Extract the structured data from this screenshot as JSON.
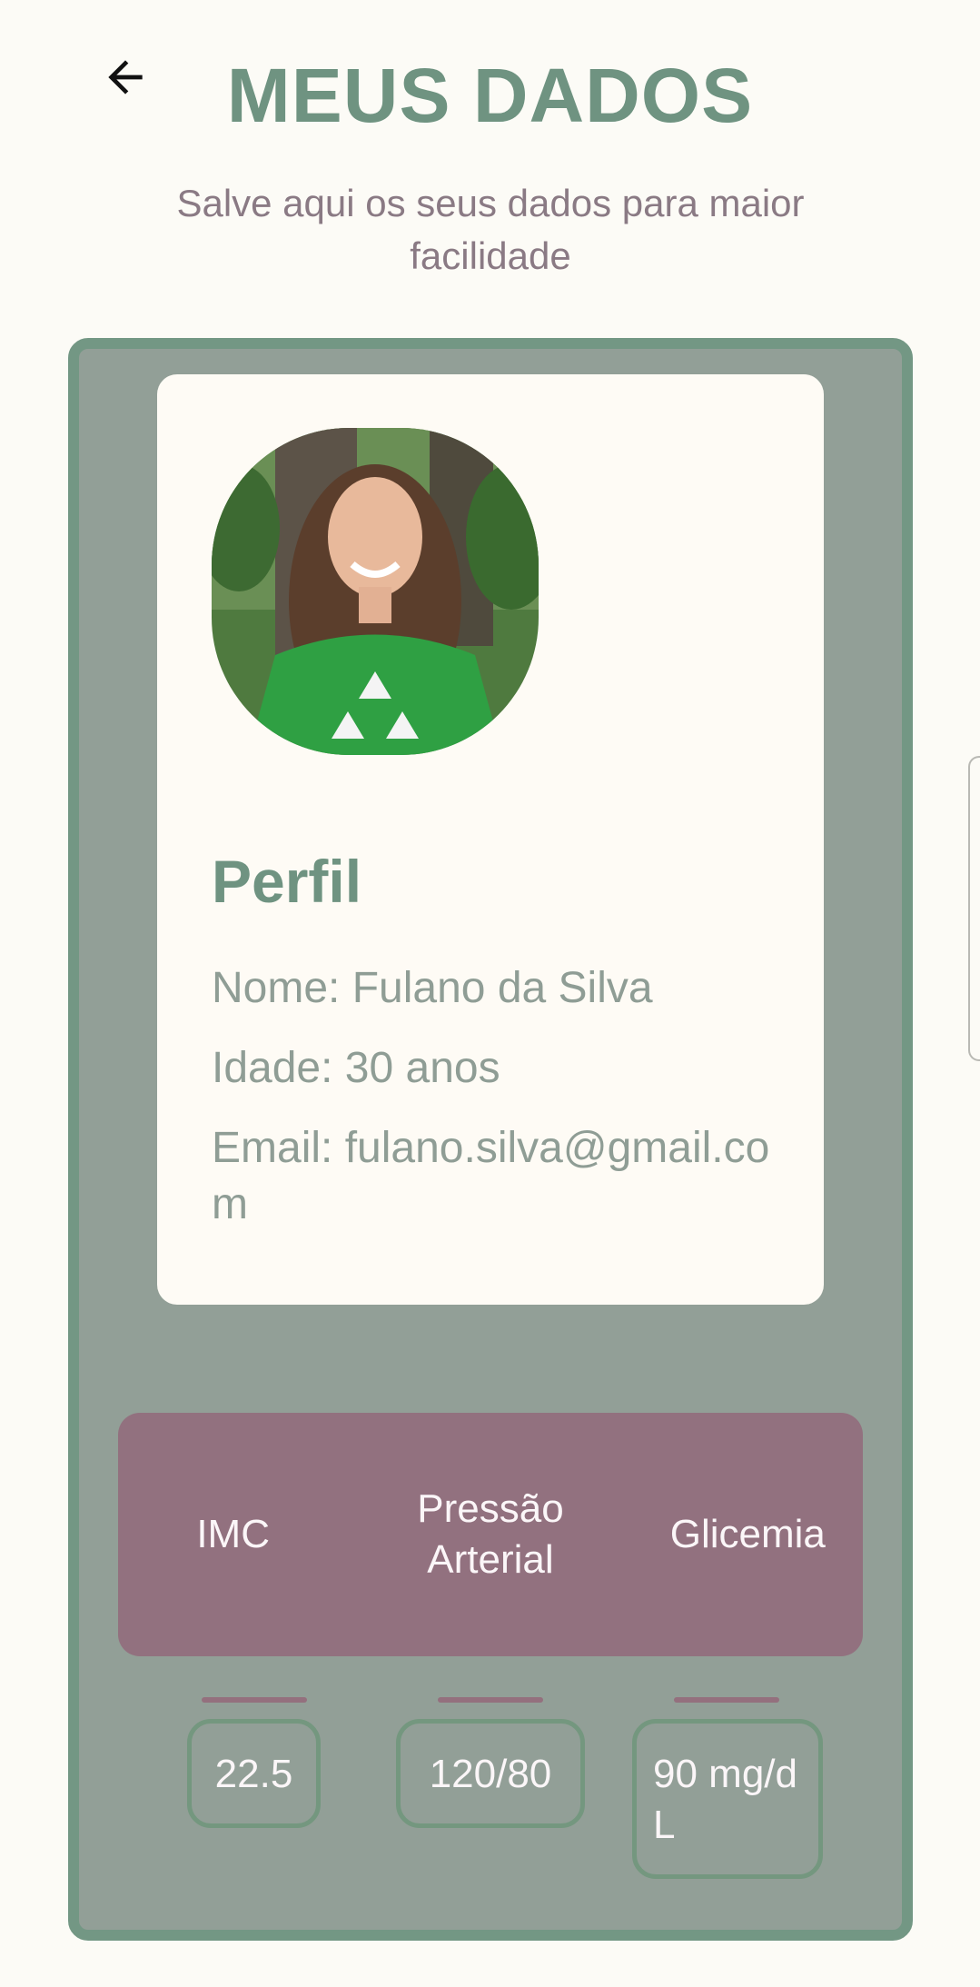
{
  "header": {
    "back_icon": "arrow-left-icon",
    "title": "MEUS DADOS",
    "subtitle": "Salve aqui os seus dados para maior facilidade"
  },
  "profile": {
    "title": "Perfil",
    "name_line": "Nome: Fulano da Silva",
    "age_line": "Idade: 30 anos",
    "email_line": "Email: fulano.silva@gmail.com"
  },
  "metrics": {
    "tabs": [
      {
        "label": "IMC"
      },
      {
        "label": "Pressão Arterial"
      },
      {
        "label": "Glicemia"
      }
    ],
    "values": [
      {
        "value": "22.5"
      },
      {
        "value": "120/80"
      },
      {
        "value": "90 mg/dL"
      }
    ]
  },
  "colors": {
    "background": "#fcfbf6",
    "accent_green": "#6f9381",
    "panel": "#929f97",
    "tab_bar": "#92717f",
    "subtitle_text": "#8a7a84"
  }
}
